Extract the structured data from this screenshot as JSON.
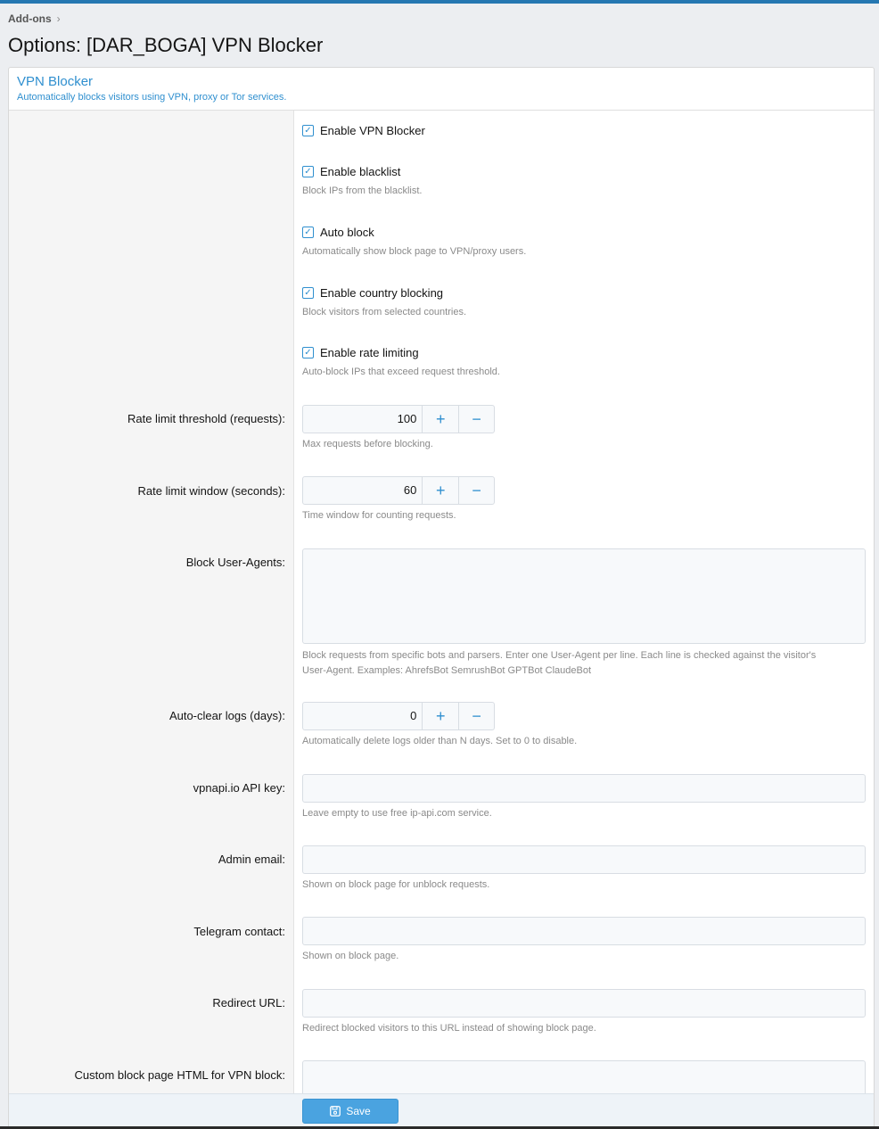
{
  "breadcrumb": {
    "item": "Add-ons",
    "chevron": "›"
  },
  "page": {
    "title": "Options: [DAR_BOGA] VPN Blocker"
  },
  "panel": {
    "title": "VPN Blocker",
    "description": "Automatically blocks visitors using VPN, proxy or Tor services."
  },
  "options": {
    "enable_vpn": {
      "label": "Enable VPN Blocker",
      "checked": true
    },
    "enable_blacklist": {
      "label": "Enable blacklist",
      "hint": "Block IPs from the blacklist.",
      "checked": true
    },
    "auto_block": {
      "label": "Auto block",
      "hint": "Automatically show block page to VPN/proxy users.",
      "checked": true
    },
    "country_blocking": {
      "label": "Enable country blocking",
      "hint": "Block visitors from selected countries.",
      "checked": true
    },
    "rate_limiting": {
      "label": "Enable rate limiting",
      "hint": "Auto-block IPs that exceed request threshold.",
      "checked": true
    },
    "rate_threshold": {
      "label": "Rate limit threshold (requests):",
      "value": "100",
      "hint": "Max requests before blocking."
    },
    "rate_window": {
      "label": "Rate limit window (seconds):",
      "value": "60",
      "hint": "Time window for counting requests."
    },
    "block_user_agents": {
      "label": "Block User-Agents:",
      "value": "",
      "hint_line1": "Block requests from specific bots and parsers. Enter one User-Agent per line. Each line is checked against the visitor's",
      "hint_line2": "User-Agent. Examples: AhrefsBot SemrushBot GPTBot ClaudeBot"
    },
    "auto_clear_logs": {
      "label": "Auto-clear logs (days):",
      "value": "0",
      "hint": "Automatically delete logs older than N days. Set to 0 to disable."
    },
    "api_key": {
      "label": "vpnapi.io API key:",
      "value": "",
      "hint": "Leave empty to use free ip-api.com service."
    },
    "admin_email": {
      "label": "Admin email:",
      "value": "",
      "hint": "Shown on block page for unblock requests."
    },
    "telegram": {
      "label": "Telegram contact:",
      "value": "",
      "hint": "Shown on block page."
    },
    "redirect_url": {
      "label": "Redirect URL:",
      "value": "",
      "hint": "Redirect blocked visitors to this URL instead of showing block page."
    },
    "custom_html": {
      "label": "Custom block page HTML for VPN block:",
      "value": ""
    }
  },
  "stepper": {
    "plus": "+",
    "minus": "−"
  },
  "checkmark": "✓",
  "footer": {
    "save_label": "Save",
    "save_icon": "save-icon"
  },
  "colors": {
    "accent": "#2f8fcf",
    "topbar": "#2577b1",
    "save_button": "#4aa3e0"
  }
}
